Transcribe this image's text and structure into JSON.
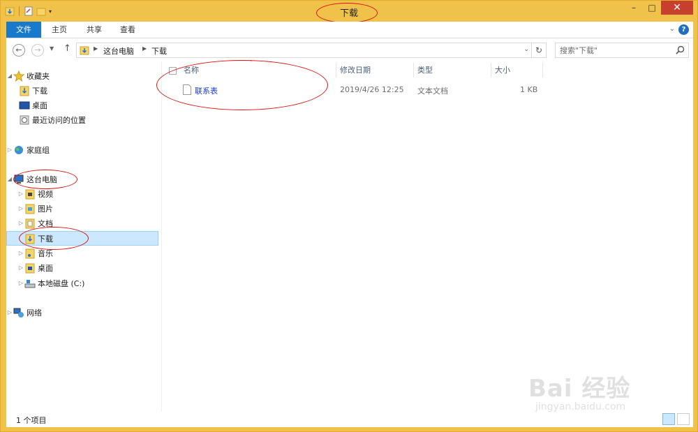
{
  "window": {
    "title": "下载",
    "controls": {
      "minimize": "–",
      "maximize": "□",
      "close": "✕"
    }
  },
  "ribbon": {
    "tabs": [
      "文件",
      "主页",
      "共享",
      "查看"
    ],
    "expand_icon": "chevron-down-icon",
    "help_label": "?"
  },
  "navigation": {
    "breadcrumb": [
      "这台电脑",
      "下载"
    ],
    "search_placeholder": "搜索\"下载\""
  },
  "nav_pane": {
    "favorites": {
      "label": "收藏夹",
      "items": [
        "下载",
        "桌面",
        "最近访问的位置"
      ]
    },
    "homegroup": {
      "label": "家庭组"
    },
    "this_pc": {
      "label": "这台电脑",
      "items": [
        "视频",
        "图片",
        "文档",
        "下载",
        "音乐",
        "桌面",
        "本地磁盘 (C:)"
      ],
      "selected": "下载"
    },
    "network": {
      "label": "网络"
    }
  },
  "file_list": {
    "columns": [
      "名称",
      "修改日期",
      "类型",
      "大小"
    ],
    "files": [
      {
        "name": "联系表",
        "modified": "2019/4/26 12:25",
        "type": "文本文档",
        "size": "1 KB"
      }
    ]
  },
  "status": {
    "count": "1 个项目"
  },
  "watermark": {
    "main": "Bai  经验",
    "sub": "jingyan.baidu.com"
  },
  "colors": {
    "title_bar": "#f0c24a",
    "file_tab": "#1979ca",
    "selection": "#cce8ff",
    "annotation": "#dd1111",
    "link": "#1a3cd4"
  }
}
